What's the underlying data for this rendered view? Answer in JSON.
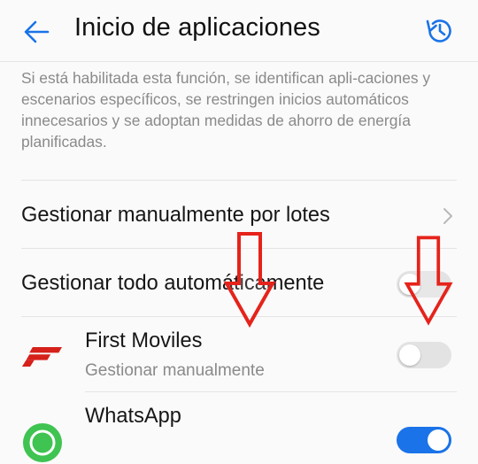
{
  "header": {
    "title": "Inicio de aplicaciones",
    "back_icon": "back-arrow-icon",
    "history_icon": "history-icon",
    "accent": "#1a73e8"
  },
  "description": "Si está habilitada esta función, se identifican apli-caciones y escenarios específicos, se restringen inicios automáticos innecesarios y se adoptan medidas de ahorro de energía planificadas.",
  "rows": {
    "manual_batch": "Gestionar manualmente por lotes",
    "auto_all": "Gestionar todo automáticamente",
    "auto_all_toggle": "off"
  },
  "apps": [
    {
      "name": "First Moviles",
      "subtitle": "Gestionar manualmente",
      "icon": "first-moviles-logo",
      "toggle": "off"
    },
    {
      "name": "WhatsApp",
      "subtitle": "",
      "icon": "whatsapp-icon",
      "toggle": "on"
    }
  ],
  "annotations": {
    "arrow_color": "#e5231b"
  }
}
